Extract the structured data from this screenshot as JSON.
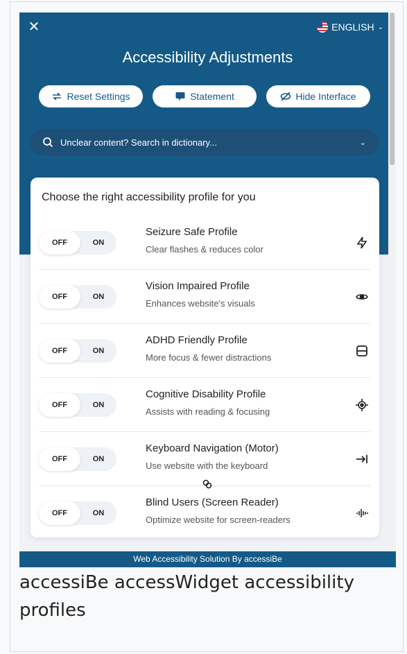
{
  "header": {
    "close_label": "✕",
    "language": "ENGLISH",
    "title": "Accessibility Adjustments",
    "actions": [
      {
        "label": "Reset Settings",
        "icon": "reset-icon"
      },
      {
        "label": "Statement",
        "icon": "statement-icon"
      },
      {
        "label": "Hide Interface",
        "icon": "hide-icon"
      }
    ],
    "search_placeholder": "Unclear content? Search in dictionary..."
  },
  "panel": {
    "title": "Choose the right accessibility profile for you",
    "toggle_off": "OFF",
    "toggle_on": "ON",
    "profiles": [
      {
        "name": "Seizure Safe Profile",
        "desc": "Clear flashes & reduces color",
        "icon": "lightning-icon"
      },
      {
        "name": "Vision Impaired Profile",
        "desc": "Enhances website's visuals",
        "icon": "eye-icon"
      },
      {
        "name": "ADHD Friendly Profile",
        "desc": "More focus & fewer distractions",
        "icon": "focus-frame-icon"
      },
      {
        "name": "Cognitive Disability Profile",
        "desc": "Assists with reading & focusing",
        "icon": "target-icon"
      },
      {
        "name": "Keyboard Navigation (Motor)",
        "desc": "Use website with the keyboard",
        "icon": "tab-arrow-icon"
      },
      {
        "name": "Blind Users (Screen Reader)",
        "desc": "Optimize website for screen-readers",
        "icon": "audio-wave-icon"
      }
    ]
  },
  "footer": {
    "text": "Web Accessibility Solution By accessiBe"
  },
  "caption": "accessiBe accessWidget accessibility profiles",
  "colors": {
    "primary": "#155a87",
    "search_bg": "#1e4f76",
    "panel_bg": "#ffffff"
  }
}
